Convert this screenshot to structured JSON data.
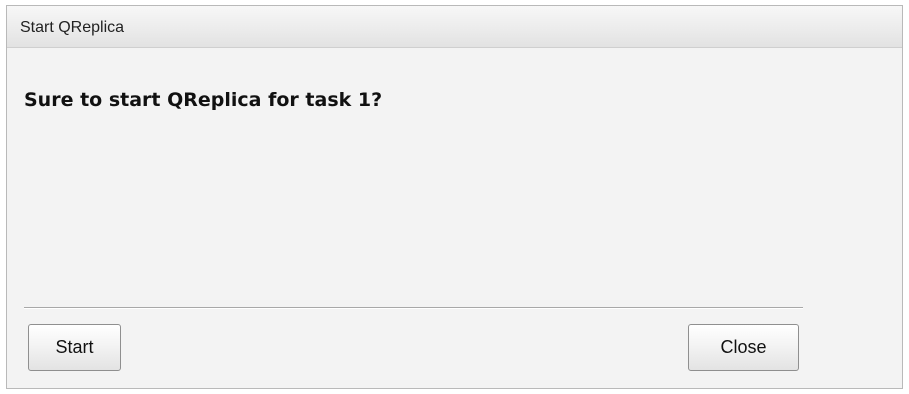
{
  "dialog": {
    "title": "Start QReplica",
    "message": "Sure to start QReplica for task 1?",
    "buttons": {
      "start_label": "Start",
      "close_label": "Close"
    }
  },
  "colors": {
    "titlebar": "#ececec",
    "body": "#f3f3f3",
    "border": "#b9b9b9"
  }
}
